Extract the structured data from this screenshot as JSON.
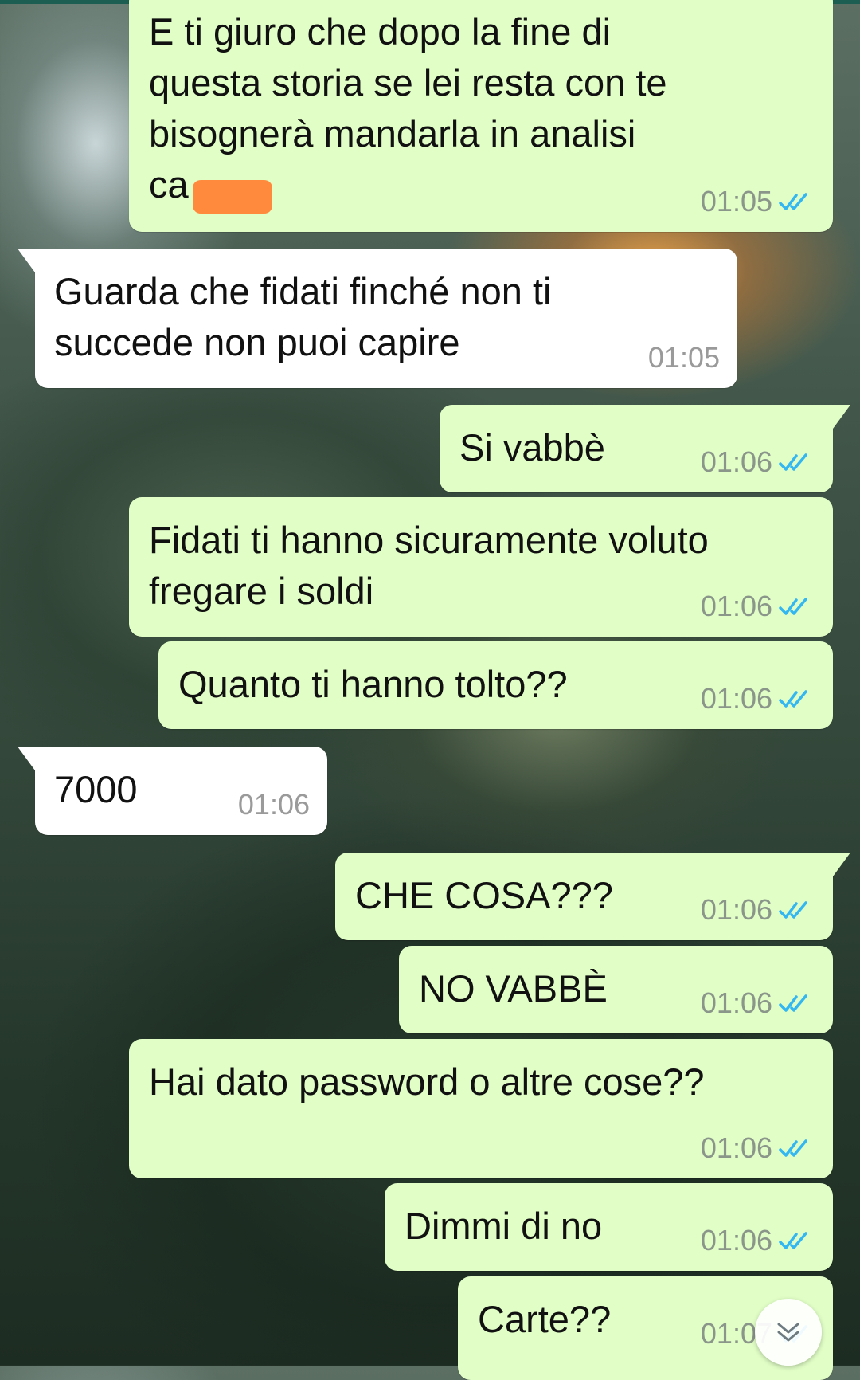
{
  "messages": [
    {
      "id": "m1",
      "dir": "out",
      "lines": [
        "E ti giuro che dopo la fine di",
        "questa storia se lei resta con te",
        "bisognerà mandarla in analisi",
        "ca"
      ],
      "time": "01:05",
      "status": "read"
    },
    {
      "id": "m2",
      "dir": "in",
      "lines": [
        "Guarda che fidati finché non ti",
        "succede non puoi capire"
      ],
      "time": "01:05"
    },
    {
      "id": "m3",
      "dir": "out",
      "lines": [
        "Si vabbè"
      ],
      "time": "01:06",
      "status": "read"
    },
    {
      "id": "m4",
      "dir": "out",
      "lines": [
        "Fidati ti hanno sicuramente voluto",
        "fregare i soldi"
      ],
      "time": "01:06",
      "status": "read"
    },
    {
      "id": "m5",
      "dir": "out",
      "lines": [
        "Quanto ti hanno tolto??"
      ],
      "time": "01:06",
      "status": "read"
    },
    {
      "id": "m6",
      "dir": "in",
      "lines": [
        "7000"
      ],
      "time": "01:06"
    },
    {
      "id": "m7",
      "dir": "out",
      "lines": [
        "CHE COSA???"
      ],
      "time": "01:06",
      "status": "read"
    },
    {
      "id": "m8",
      "dir": "out",
      "lines": [
        "NO VABBÈ"
      ],
      "time": "01:06",
      "status": "read"
    },
    {
      "id": "m9",
      "dir": "out",
      "lines": [
        "Hai dato password o altre cose??"
      ],
      "time": "01:06",
      "status": "read"
    },
    {
      "id": "m10",
      "dir": "out",
      "lines": [
        "Dimmi di no"
      ],
      "time": "01:06",
      "status": "read"
    },
    {
      "id": "m11",
      "dir": "out",
      "lines": [
        "Carte??"
      ],
      "time": "01:07",
      "status": "read"
    }
  ],
  "colors": {
    "outgoing_bubble": "#e1fec6",
    "incoming_bubble": "#ffffff",
    "read_ticks": "#34b7f1",
    "redaction": "#ff8a3d"
  },
  "icons": {
    "read_receipt": "double-check-icon",
    "scroll_down": "chevron-double-down-icon"
  }
}
